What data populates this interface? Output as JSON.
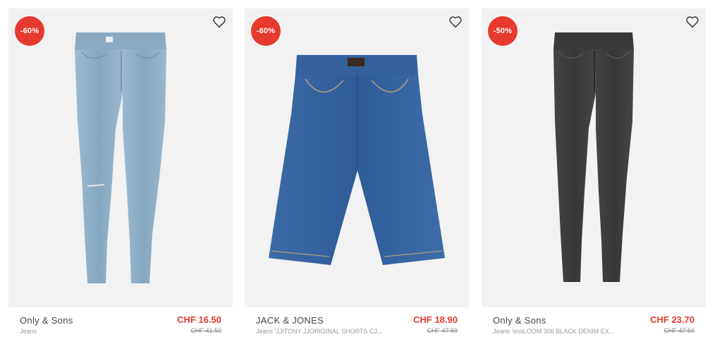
{
  "products": [
    {
      "discount": "-60%",
      "brand": "Only & Sons",
      "subtitle": "Jeans",
      "price": "CHF 16.50",
      "old_price": "CHF 41.50",
      "image": "light-blue-skinny-jeans",
      "color": "#8fb0c9"
    },
    {
      "discount": "-60%",
      "brand": "JACK & JONES",
      "subtitle": "Jeans 'JJITONY JJORIGINAL SHORTS CJ...",
      "price": "CHF 18.90",
      "old_price": "CHF 47.50",
      "image": "blue-denim-shorts",
      "color": "#3a6aa8"
    },
    {
      "discount": "-50%",
      "brand": "Only & Sons",
      "subtitle": "Jeans 'onsLOOM 306 BLACK DENIM EX...",
      "price": "CHF 23.70",
      "old_price": "CHF 47.50",
      "image": "black-skinny-jeans",
      "color": "#3d3d3d"
    }
  ],
  "colors": {
    "accent_red": "#e63a2e",
    "card_bg": "#f2f2f2"
  }
}
